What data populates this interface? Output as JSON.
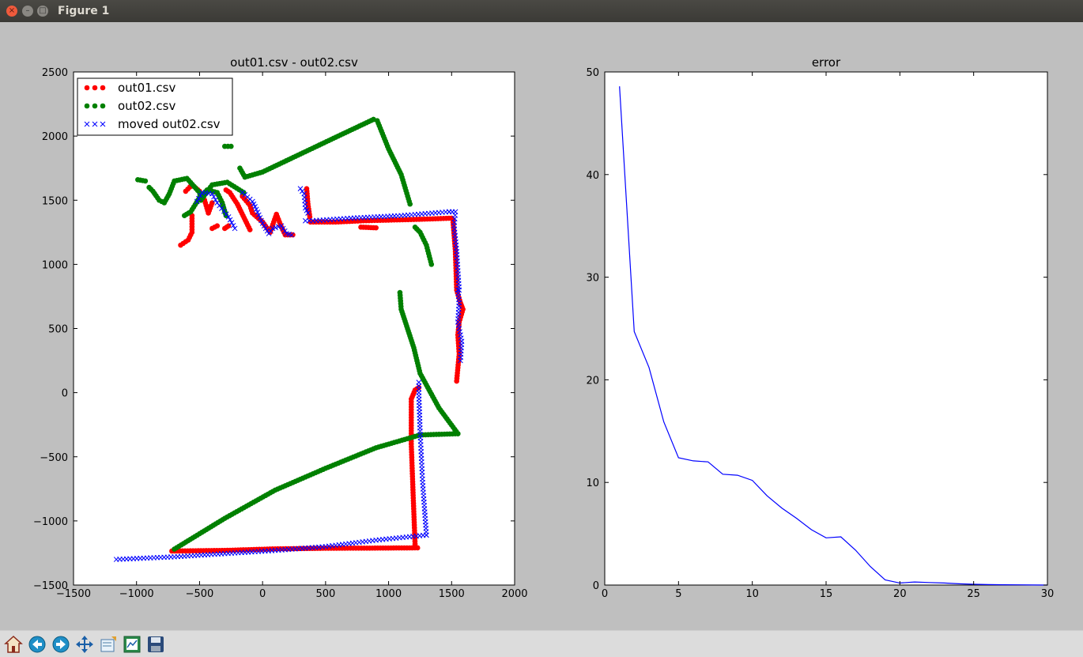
{
  "window": {
    "title": "Figure 1",
    "close_glyph": "×",
    "minimize_glyph": "–",
    "maximize_glyph": "□"
  },
  "toolbar": {
    "buttons": [
      {
        "name": "home-button",
        "icon": "home-icon"
      },
      {
        "name": "back-button",
        "icon": "arrow-left-icon"
      },
      {
        "name": "forward-button",
        "icon": "arrow-right-icon"
      },
      {
        "name": "pan-button",
        "icon": "move-arrows-icon"
      },
      {
        "name": "zoom-button",
        "icon": "zoom-rect-icon"
      },
      {
        "name": "configure-subplots-button",
        "icon": "subplots-icon"
      },
      {
        "name": "save-button",
        "icon": "floppy-disk-icon"
      }
    ]
  },
  "chart_data": [
    {
      "type": "scatter",
      "title": "out01.csv - out02.csv",
      "xlim": [
        -1500,
        2000
      ],
      "ylim": [
        -1500,
        2500
      ],
      "xticks": [
        -1500,
        -1000,
        -500,
        0,
        500,
        1000,
        1500,
        2000
      ],
      "yticks": [
        -1500,
        -1000,
        -500,
        0,
        500,
        1000,
        1500,
        2000,
        2500
      ],
      "xtick_labels": [
        "−1500",
        "−1000",
        "−500",
        "0",
        "500",
        "1000",
        "1500",
        "2000"
      ],
      "ytick_labels": [
        "−1500",
        "−1000",
        "−500",
        "0",
        "500",
        "1000",
        "1500",
        "2000",
        "2500"
      ],
      "grid": false,
      "legend_position": "top-left",
      "series": [
        {
          "name": "out01.csv",
          "marker": "o",
          "color": "#ff0000",
          "polylines": [
            [
              [
                -720,
                -1235
              ],
              [
                -300,
                -1230
              ],
              [
                100,
                -1218
              ],
              [
                500,
                -1213
              ],
              [
                850,
                -1212
              ],
              [
                1230,
                -1210
              ]
            ],
            [
              [
                1210,
                -1180
              ],
              [
                1195,
                -800
              ],
              [
                1180,
                -400
              ],
              [
                1180,
                -50
              ],
              [
                1210,
                20
              ],
              [
                1240,
                40
              ]
            ],
            [
              [
                1540,
                90
              ],
              [
                1560,
                300
              ],
              [
                1550,
                450
              ],
              [
                1560,
                550
              ],
              [
                1590,
                650
              ],
              [
                1570,
                700
              ],
              [
                1540,
                800
              ],
              [
                1530,
                1100
              ],
              [
                1510,
                1350
              ]
            ],
            [
              [
                1500,
                1360
              ],
              [
                1200,
                1350
              ],
              [
                1000,
                1345
              ],
              [
                800,
                1340
              ],
              [
                580,
                1330
              ],
              [
                380,
                1330
              ]
            ],
            [
              [
                780,
                1290
              ],
              [
                900,
                1285
              ]
            ],
            [
              [
                350,
                1590
              ],
              [
                360,
                1470
              ],
              [
                375,
                1370
              ]
            ],
            [
              [
                240,
                1230
              ],
              [
                180,
                1230
              ],
              [
                150,
                1290
              ],
              [
                110,
                1390
              ],
              [
                60,
                1250
              ],
              [
                0,
                1330
              ],
              [
                -80,
                1400
              ],
              [
                -100,
                1460
              ],
              [
                -160,
                1530
              ]
            ],
            [
              [
                -100,
                1270
              ],
              [
                -200,
                1470
              ],
              [
                -260,
                1560
              ],
              [
                -290,
                1580
              ]
            ],
            [
              [
                -400,
                1480
              ],
              [
                -430,
                1400
              ],
              [
                -460,
                1500
              ],
              [
                -500,
                1570
              ],
              [
                -560,
                1620
              ],
              [
                -610,
                1570
              ]
            ],
            [
              [
                -560,
                1380
              ],
              [
                -560,
                1250
              ],
              [
                -590,
                1190
              ],
              [
                -650,
                1150
              ]
            ],
            [
              [
                -400,
                1280
              ],
              [
                -380,
                1290
              ],
              [
                -360,
                1300
              ]
            ],
            [
              [
                -300,
                1280
              ],
              [
                -270,
                1300
              ]
            ]
          ]
        },
        {
          "name": "out02.csv",
          "marker": "o",
          "color": "#008000",
          "polylines": [
            [
              [
                -700,
                -1220
              ],
              [
                -300,
                -980
              ],
              [
                100,
                -760
              ],
              [
                500,
                -590
              ],
              [
                900,
                -430
              ],
              [
                1250,
                -330
              ],
              [
                1550,
                -320
              ]
            ],
            [
              [
                1550,
                -320
              ],
              [
                1400,
                -120
              ],
              [
                1250,
                150
              ],
              [
                1200,
                350
              ],
              [
                1150,
                500
              ],
              [
                1100,
                650
              ],
              [
                1090,
                780
              ]
            ],
            [
              [
                1340,
                1000
              ],
              [
                1300,
                1150
              ],
              [
                1250,
                1250
              ],
              [
                1210,
                1290
              ]
            ],
            [
              [
                1170,
                1470
              ],
              [
                1100,
                1700
              ],
              [
                1000,
                1900
              ],
              [
                910,
                2120
              ],
              [
                880,
                2130
              ]
            ],
            [
              [
                880,
                2130
              ],
              [
                600,
                2000
              ],
              [
                300,
                1860
              ],
              [
                0,
                1720
              ],
              [
                -140,
                1680
              ],
              [
                -180,
                1750
              ]
            ],
            [
              [
                -250,
                1920
              ],
              [
                -300,
                1920
              ]
            ],
            [
              [
                -150,
                1560
              ],
              [
                -280,
                1640
              ],
              [
                -400,
                1620
              ],
              [
                -490,
                1500
              ],
              [
                -500,
                1560
              ],
              [
                -600,
                1670
              ],
              [
                -700,
                1650
              ],
              [
                -740,
                1550
              ],
              [
                -780,
                1480
              ],
              [
                -820,
                1500
              ],
              [
                -870,
                1570
              ],
              [
                -900,
                1600
              ]
            ],
            [
              [
                -930,
                1650
              ],
              [
                -990,
                1660
              ]
            ],
            [
              [
                -290,
                1380
              ],
              [
                -320,
                1480
              ],
              [
                -360,
                1560
              ],
              [
                -440,
                1580
              ],
              [
                -500,
                1520
              ],
              [
                -570,
                1410
              ],
              [
                -620,
                1380
              ]
            ]
          ]
        },
        {
          "name": "moved out02.csv",
          "marker": "x",
          "color": "#0000ff",
          "polylines": [
            [
              [
                -1160,
                -1300
              ],
              [
                -700,
                -1280
              ],
              [
                -300,
                -1255
              ],
              [
                100,
                -1230
              ],
              [
                500,
                -1200
              ],
              [
                900,
                -1150
              ],
              [
                1300,
                -1110
              ]
            ],
            [
              [
                1300,
                -1110
              ],
              [
                1270,
                -700
              ],
              [
                1250,
                -300
              ],
              [
                1240,
                0
              ],
              [
                1240,
                80
              ]
            ],
            [
              [
                1570,
                250
              ],
              [
                1580,
                400
              ],
              [
                1550,
                550
              ],
              [
                1560,
                700
              ],
              [
                1550,
                800
              ]
            ],
            [
              [
                1560,
                800
              ],
              [
                1540,
                1100
              ],
              [
                1520,
                1300
              ],
              [
                1530,
                1410
              ],
              [
                1480,
                1410
              ]
            ],
            [
              [
                1480,
                1410
              ],
              [
                1100,
                1380
              ],
              [
                700,
                1360
              ],
              [
                400,
                1340
              ],
              [
                340,
                1340
              ]
            ],
            [
              [
                300,
                1590
              ],
              [
                330,
                1550
              ],
              [
                340,
                1440
              ],
              [
                360,
                1400
              ]
            ],
            [
              [
                230,
                1230
              ],
              [
                190,
                1240
              ],
              [
                150,
                1300
              ],
              [
                80,
                1280
              ],
              [
                50,
                1240
              ],
              [
                0,
                1320
              ],
              [
                -60,
                1450
              ],
              [
                -80,
                1490
              ],
              [
                -160,
                1560
              ]
            ],
            [
              [
                -220,
                1280
              ],
              [
                -270,
                1370
              ],
              [
                -360,
                1480
              ],
              [
                -400,
                1550
              ],
              [
                -480,
                1560
              ],
              [
                -520,
                1490
              ]
            ]
          ]
        }
      ]
    },
    {
      "type": "line",
      "title": "error",
      "xlim": [
        0,
        30
      ],
      "ylim": [
        0,
        50
      ],
      "xticks": [
        0,
        5,
        10,
        15,
        20,
        25,
        30
      ],
      "yticks": [
        0,
        10,
        20,
        30,
        40,
        50
      ],
      "xtick_labels": [
        "0",
        "5",
        "10",
        "15",
        "20",
        "25",
        "30"
      ],
      "ytick_labels": [
        "0",
        "10",
        "20",
        "30",
        "40",
        "50"
      ],
      "grid": false,
      "series": [
        {
          "color": "#0000ff",
          "x": [
            1,
            2,
            3,
            4,
            5,
            6,
            7,
            8,
            9,
            10,
            11,
            12,
            13,
            14,
            15,
            16,
            17,
            18,
            19,
            20,
            21,
            22,
            23,
            24,
            25,
            26,
            27,
            28,
            29,
            30
          ],
          "y": [
            48.6,
            24.7,
            21.2,
            15.9,
            12.4,
            12.1,
            12.0,
            10.8,
            10.7,
            10.2,
            8.7,
            7.5,
            6.5,
            5.4,
            4.6,
            4.7,
            3.4,
            1.8,
            0.5,
            0.2,
            0.3,
            0.25,
            0.2,
            0.12,
            0.08,
            0.05,
            0.03,
            0.02,
            0.01,
            0.0
          ]
        }
      ]
    }
  ]
}
